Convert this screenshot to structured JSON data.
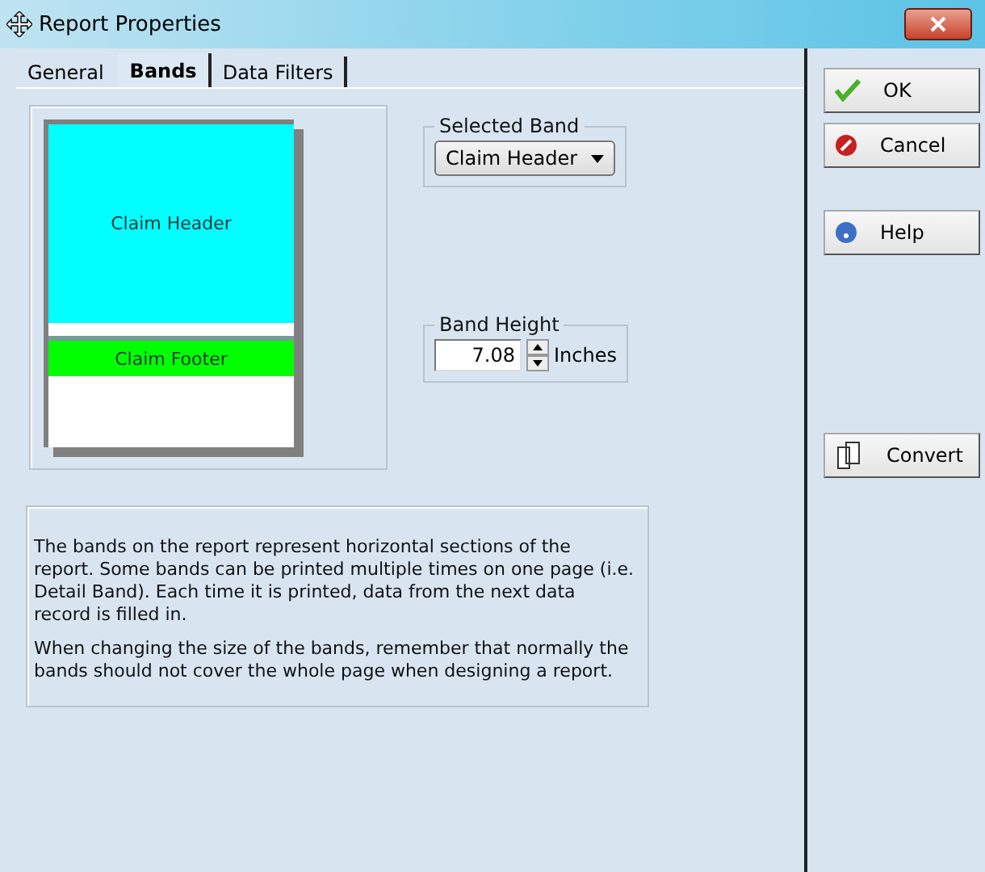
{
  "window": {
    "title": "Report Properties"
  },
  "tabs": [
    {
      "label": "General",
      "selected": false
    },
    {
      "label": "Bands",
      "selected": true
    },
    {
      "label": "Data Filters",
      "selected": false
    }
  ],
  "preview": {
    "bands": [
      {
        "kind": "header",
        "name": "Claim Header",
        "color": "#00ffff"
      },
      {
        "kind": "footer",
        "name": "Claim Footer",
        "color": "#00ff00"
      }
    ]
  },
  "selected_band": {
    "legend": "Selected Band",
    "value": "Claim Header"
  },
  "band_height": {
    "legend": "Band Height",
    "value": "7.08",
    "unit": "Inches"
  },
  "info": [
    "The bands on the report represent horizontal sections of the report. Some bands can be printed multiple times on one page (i.e. Detail Band). Each time it is printed, data from the next data record is filled in.",
    "When changing the size of the bands, remember that normally the bands should not cover the whole page when designing a report."
  ],
  "buttons": [
    {
      "kind": "ok",
      "label": "OK"
    },
    {
      "kind": "cancel",
      "label": "Cancel"
    },
    {
      "kind": "help",
      "label": "Help"
    },
    {
      "kind": "convert",
      "label": "Convert"
    }
  ]
}
